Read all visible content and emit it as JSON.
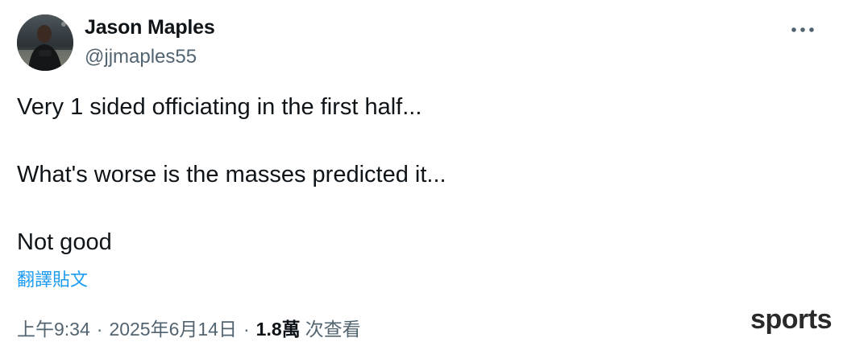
{
  "author": {
    "display_name": "Jason Maples",
    "handle": "@jjmaples55",
    "avatar_icon": "profile-photo"
  },
  "tweet": {
    "paragraphs": [
      "Very 1 sided officiating in the first half...",
      "What's worse is the masses predicted it...",
      "Not good"
    ],
    "translate_label": "翻譯貼文"
  },
  "meta": {
    "time": "上午9:34",
    "separator": "·",
    "date": "2025年6月14日",
    "views_count": "1.8萬",
    "views_label": "次查看"
  },
  "more_icon": "more-horizontal-icon",
  "watermark": "sports",
  "colors": {
    "text_primary": "#0f1419",
    "text_secondary": "#536471",
    "link": "#1d9bf0"
  }
}
